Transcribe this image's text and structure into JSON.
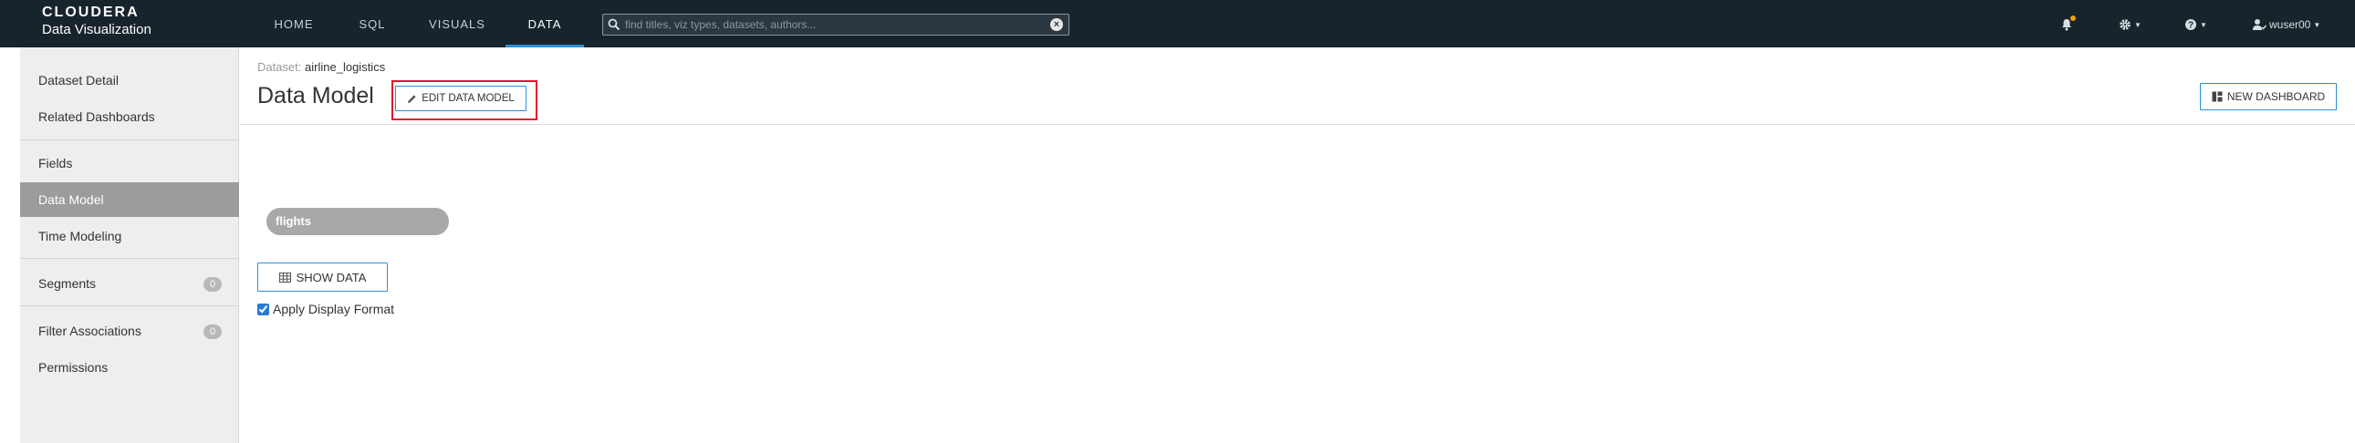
{
  "brand": {
    "line1": "CLOUDERA",
    "line2": "Data Visualization"
  },
  "nav": {
    "tabs": [
      {
        "label": "HOME"
      },
      {
        "label": "SQL"
      },
      {
        "label": "VISUALS"
      },
      {
        "label": "DATA"
      }
    ],
    "active_tab": "DATA"
  },
  "search": {
    "placeholder": "find titles, viz types, datasets, authors..."
  },
  "user": {
    "name": "wuser00"
  },
  "sidebar": {
    "items": [
      {
        "label": "Dataset Detail"
      },
      {
        "label": "Related Dashboards"
      },
      {
        "label": "Fields"
      },
      {
        "label": "Data Model"
      },
      {
        "label": "Time Modeling"
      },
      {
        "label": "Segments",
        "badge": "0"
      },
      {
        "label": "Filter Associations",
        "badge": "0"
      },
      {
        "label": "Permissions"
      }
    ],
    "active_item": "Data Model"
  },
  "main": {
    "breadcrumb_label": "Dataset:",
    "breadcrumb_value": "airline_logistics",
    "title": "Data Model",
    "edit_button": "EDIT DATA MODEL",
    "new_dashboard_button": "NEW DASHBOARD",
    "table_pill": "flights",
    "show_data_button": "SHOW DATA",
    "apply_display_format": "Apply Display Format"
  },
  "colors": {
    "topbar": "#17242c",
    "accent": "#2b8ed8",
    "highlight": "#e4142a",
    "sidebar_active": "#9c9c9c"
  }
}
